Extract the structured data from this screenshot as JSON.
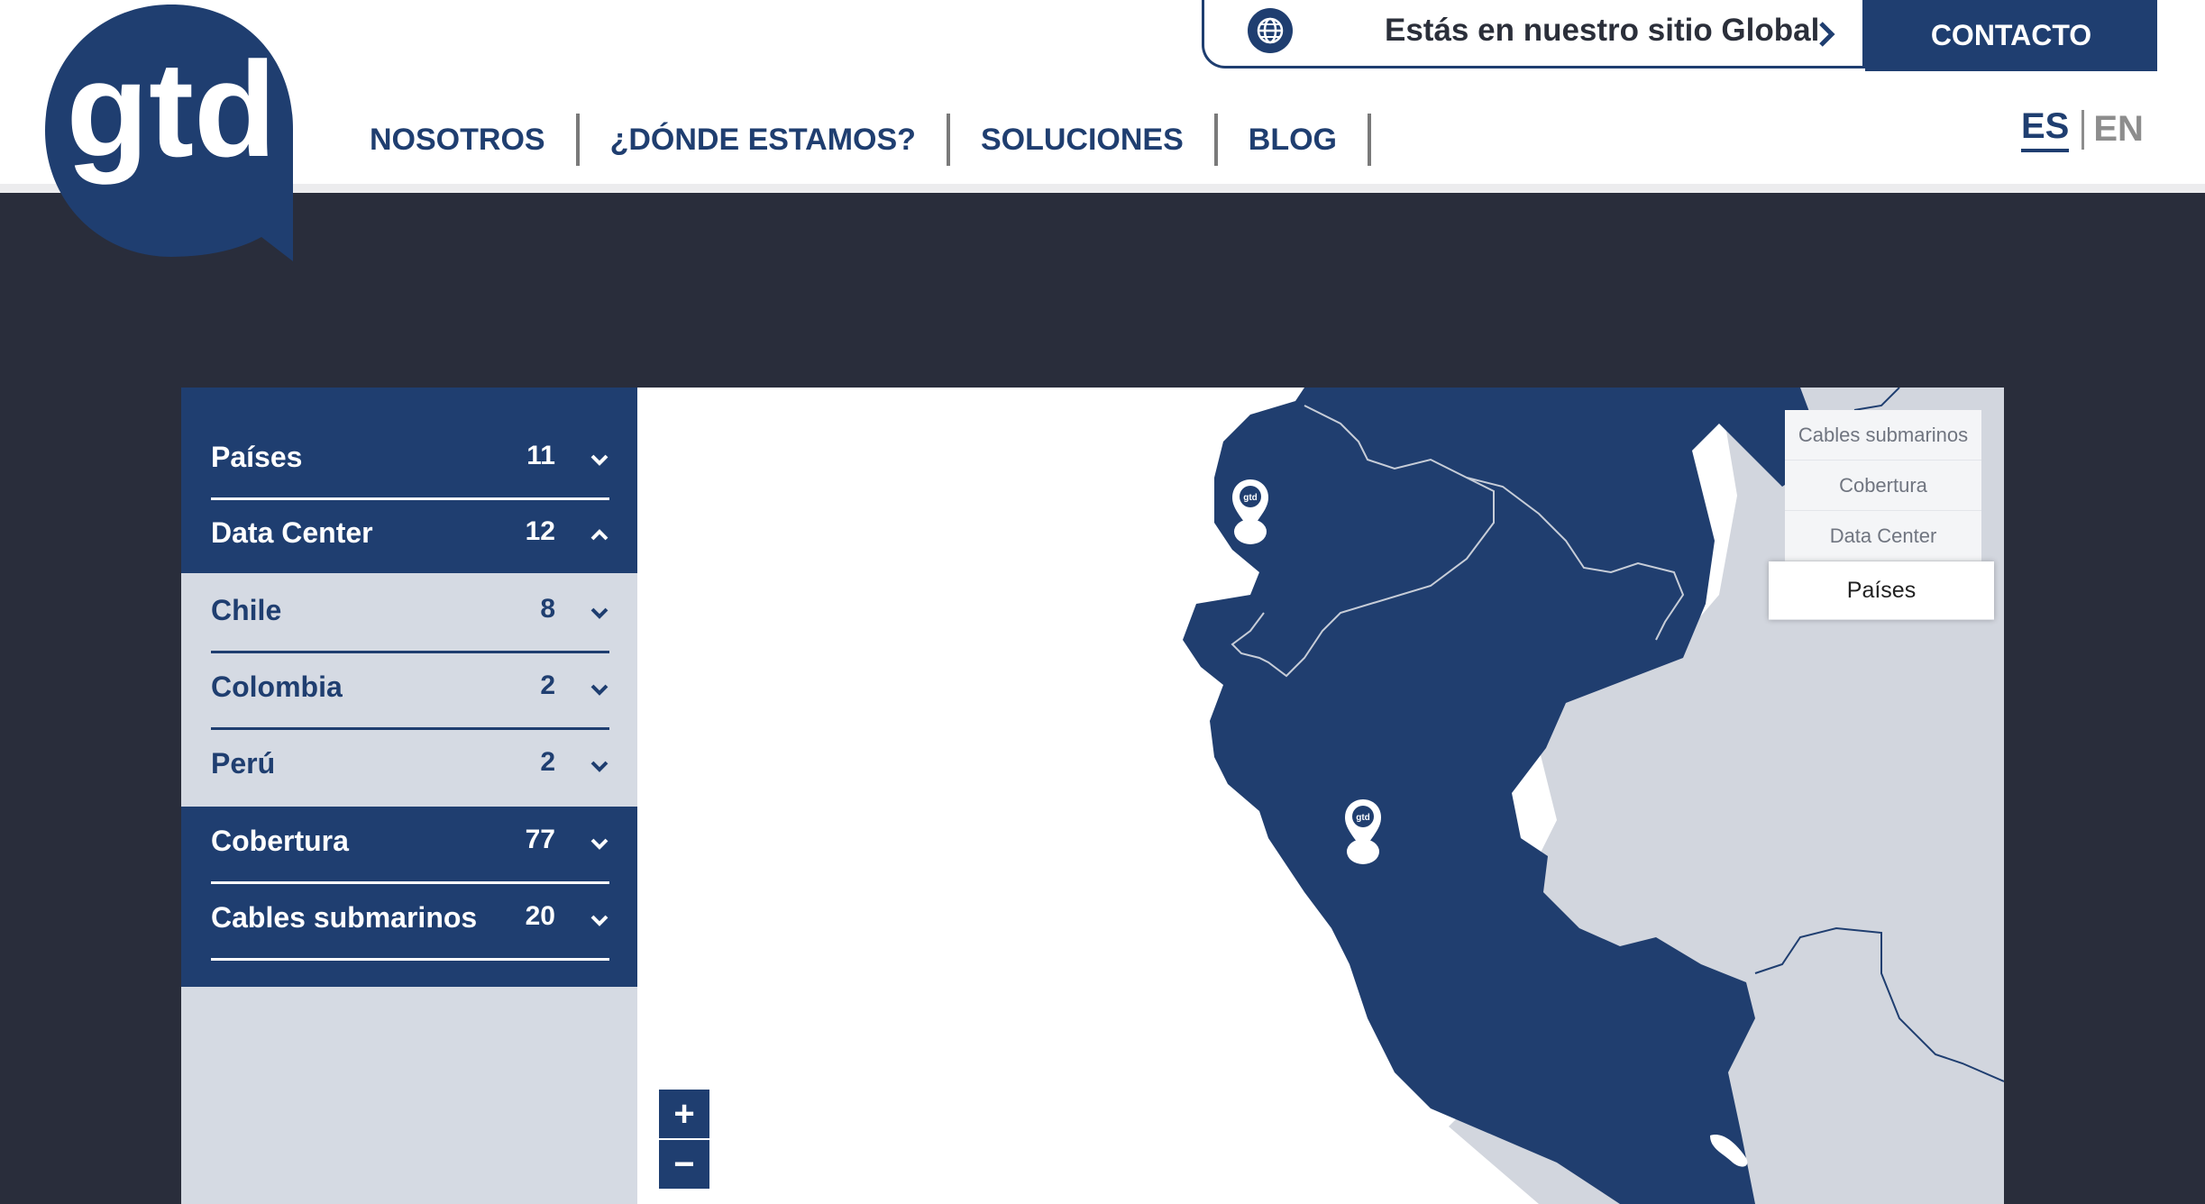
{
  "header": {
    "logo_text": "gtd",
    "nav": [
      "NOSOTROS",
      "¿DÓNDE ESTAMOS?",
      "SOLUCIONES",
      "BLOG"
    ],
    "global_banner": "Estás en nuestro sitio Global",
    "contact": "CONTACTO",
    "lang_es": "ES",
    "lang_en": "EN"
  },
  "sidebar": {
    "rows": [
      {
        "label": "Países",
        "count": "11",
        "expanded": false
      },
      {
        "label": "Data Center",
        "count": "12",
        "expanded": true
      },
      {
        "label": "Chile",
        "count": "8",
        "expanded": false
      },
      {
        "label": "Colombia",
        "count": "2",
        "expanded": false
      },
      {
        "label": "Perú",
        "count": "2",
        "expanded": false
      },
      {
        "label": "Cobertura",
        "count": "77",
        "expanded": false
      },
      {
        "label": "Cables submarinos",
        "count": "20",
        "expanded": false
      }
    ]
  },
  "map": {
    "layers": [
      "Cables submarinos",
      "Cobertura",
      "Data Center",
      "Países"
    ],
    "active_layer": "Países",
    "zoom_in": "+",
    "zoom_out": "−",
    "colors": {
      "land": "#203e6f",
      "neighbor": "#d2d6de",
      "sea": "#ffffff"
    }
  }
}
